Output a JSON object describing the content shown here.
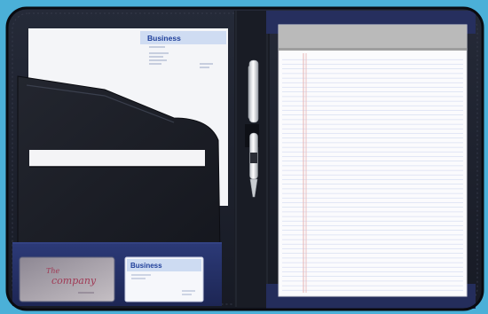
{
  "scene": {
    "background_color": "#4bb0d8",
    "folder_color": "#1e2230",
    "folder_edge_color": "#0f1118",
    "accent_color": "#27346a",
    "pad_header_color": "#b9b9b9",
    "pad_line_color": "#cfd7ef",
    "pad_margin_color": "#e7b4b4"
  },
  "letterhead": {
    "heading": "Business"
  },
  "business_card": {
    "heading": "Business"
  },
  "company_card": {
    "line1": "The",
    "line2": "company"
  }
}
